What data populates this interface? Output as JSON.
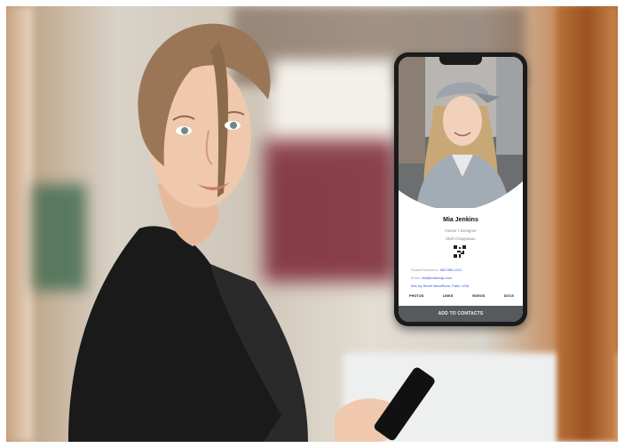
{
  "photo": {
    "scene": "woman-holding-smartphone",
    "phone_card": {
      "name": "Mia Jenkins",
      "role": "Owner / Designer",
      "company": "Mall Chappeaux",
      "studio_label": "Studio/Showroom:",
      "studio_value": "555-555-1212",
      "email_label": "Email:",
      "email_value": "mia@mallchap.com",
      "address": "548 Ivy Street MandStore, Paris. USA",
      "tabs": [
        "PHOTOS",
        "LINKS",
        "VIDEOS",
        "DOCS"
      ],
      "add_button": "ADD TO CONTACTS",
      "accent_color": "#2a58c8",
      "button_color": "#555a5f"
    }
  }
}
